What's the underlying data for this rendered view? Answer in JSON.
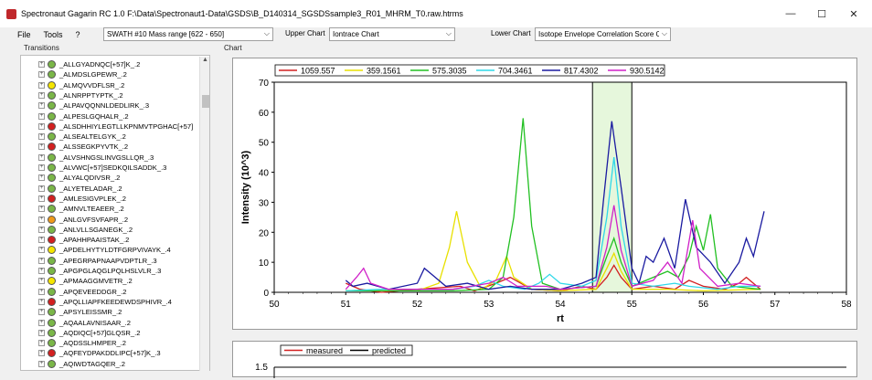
{
  "window": {
    "title": "Spectronaut Gagarin RC 1.0  F:\\Data\\Spectronaut1-Data\\GSDS\\B_D140314_SGSDSsample3_R01_MHRM_T0.raw.htrms",
    "minimize": "—",
    "maximize": "☐",
    "close": "✕"
  },
  "menu": {
    "file": "File",
    "tools": "Tools",
    "help": "?"
  },
  "toolbar": {
    "swath_select": "SWATH #10   Mass range [622 - 650]",
    "upper_chart_label": "Upper Chart",
    "upper_chart_select": "Iontrace Chart",
    "lower_chart_label": "Lower Chart",
    "lower_chart_select": "Isotope Envelope Correlation Score Ch"
  },
  "panels": {
    "transitions": "Transitions",
    "chart": "Chart"
  },
  "transitions": [
    {
      "label": "_ALLGYADNQC[+57]K_.2",
      "color": "#7ab648"
    },
    {
      "label": "_ALMDSLGPEWR_.2",
      "color": "#7ab648"
    },
    {
      "label": "_ALMQVVDFLSR_.2",
      "color": "#f4e500"
    },
    {
      "label": "_ALNRPPTYPTK_.2",
      "color": "#7ab648"
    },
    {
      "label": "_ALPAVQQNNLDEDLIRK_.3",
      "color": "#7ab648"
    },
    {
      "label": "_ALPESLGQHALR_.2",
      "color": "#7ab648"
    },
    {
      "label": "_ALSDHHIYLEGTLLKPNMVTPGHAC[+57]",
      "color": "#d22020"
    },
    {
      "label": "_ALSEALTELGYK_.2",
      "color": "#7ab648"
    },
    {
      "label": "_ALSSEGKPYVTK_.2",
      "color": "#d22020"
    },
    {
      "label": "_ALVSHNGSLINVGSLLQR_.3",
      "color": "#7ab648"
    },
    {
      "label": "_ALVWC[+57]SEDKQILSADDK_.3",
      "color": "#7ab648"
    },
    {
      "label": "_ALYALQDIVSR_.2",
      "color": "#7ab648"
    },
    {
      "label": "_ALYETELADAR_.2",
      "color": "#7ab648"
    },
    {
      "label": "_AMLESIGVPLEK_.2",
      "color": "#d22020"
    },
    {
      "label": "_AMNVLTEAEER_.2",
      "color": "#7ab648"
    },
    {
      "label": "_ANLGVFSVFAPR_.2",
      "color": "#f09a1a"
    },
    {
      "label": "_ANLVLLSGANEGK_.2",
      "color": "#7ab648"
    },
    {
      "label": "_APAHHPAAISTAK_.2",
      "color": "#d22020"
    },
    {
      "label": "_APDELHYTYLDTFGRPVIVAYK_.4",
      "color": "#f4e500"
    },
    {
      "label": "_APEGRPAPNAAPVDPTLR_.3",
      "color": "#7ab648"
    },
    {
      "label": "_APGPGLAQGLPQLHSLVLR_.3",
      "color": "#7ab648"
    },
    {
      "label": "_APMAAGGMVETR_.2",
      "color": "#f4e500"
    },
    {
      "label": "_APQEVEEDDGR_.2",
      "color": "#7ab648"
    },
    {
      "label": "_APQLLIAPFKEEDEWDSPHIVR_.4",
      "color": "#d22020"
    },
    {
      "label": "_APSYLEISSMR_.2",
      "color": "#7ab648"
    },
    {
      "label": "_AQAALAVNISAAR_.2",
      "color": "#7ab648"
    },
    {
      "label": "_AQDIQC[+57]GLQSR_.2",
      "color": "#7ab648"
    },
    {
      "label": "_AQDSSLHMPER_.2",
      "color": "#7ab648"
    },
    {
      "label": "_AQFEYDPAKDDLIPC[+57]K_.3",
      "color": "#d22020"
    },
    {
      "label": "_AQIWDTAGQER_.2",
      "color": "#7ab648"
    }
  ],
  "upper_chart": {
    "chart_data": {
      "type": "line",
      "xlabel": "rt",
      "ylabel": "Intensity (10^3)",
      "xlim": [
        50,
        58
      ],
      "ylim": [
        0,
        70
      ],
      "xticks": [
        "50",
        "51",
        "52",
        "53",
        "54",
        "55",
        "56",
        "57",
        "58"
      ],
      "yticks": [
        "0",
        "10",
        "20",
        "30",
        "40",
        "50",
        "60",
        "70"
      ],
      "highlight_range": [
        54.45,
        55.0
      ],
      "legend_position": "top-left",
      "series": [
        {
          "name": "1059.557",
          "color": "#d22020",
          "points": [
            [
              51.0,
              3
            ],
            [
              51.2,
              1
            ],
            [
              51.5,
              0
            ],
            [
              52.0,
              1
            ],
            [
              52.6,
              2
            ],
            [
              52.8,
              0.5
            ],
            [
              53.1,
              3
            ],
            [
              53.3,
              5
            ],
            [
              53.6,
              1
            ],
            [
              54.0,
              0.5
            ],
            [
              54.3,
              2
            ],
            [
              54.5,
              1
            ],
            [
              54.65,
              5
            ],
            [
              54.75,
              9
            ],
            [
              54.85,
              5
            ],
            [
              55.0,
              1
            ],
            [
              55.3,
              2
            ],
            [
              55.6,
              1
            ],
            [
              55.8,
              4
            ],
            [
              56.0,
              2
            ],
            [
              56.3,
              1
            ],
            [
              56.5,
              3
            ],
            [
              56.6,
              5
            ],
            [
              56.8,
              1
            ]
          ]
        },
        {
          "name": "359.1561",
          "color": "#e8e000",
          "points": [
            [
              51.0,
              0.5
            ],
            [
              51.5,
              0.5
            ],
            [
              52.0,
              0.5
            ],
            [
              52.3,
              3
            ],
            [
              52.45,
              15
            ],
            [
              52.55,
              27
            ],
            [
              52.7,
              10
            ],
            [
              52.9,
              1
            ],
            [
              53.1,
              4
            ],
            [
              53.25,
              12
            ],
            [
              53.35,
              5
            ],
            [
              53.6,
              1
            ],
            [
              54.0,
              0.5
            ],
            [
              54.5,
              1
            ],
            [
              54.65,
              8
            ],
            [
              54.75,
              13
            ],
            [
              54.85,
              7
            ],
            [
              55.0,
              1
            ],
            [
              55.5,
              1
            ],
            [
              56.0,
              0.5
            ],
            [
              56.8,
              1
            ]
          ]
        },
        {
          "name": "575.3035",
          "color": "#22c022",
          "points": [
            [
              51.0,
              0.5
            ],
            [
              51.5,
              0.5
            ],
            [
              52.0,
              0.5
            ],
            [
              52.5,
              0.5
            ],
            [
              53.0,
              1
            ],
            [
              53.2,
              5
            ],
            [
              53.35,
              25
            ],
            [
              53.48,
              58
            ],
            [
              53.6,
              22
            ],
            [
              53.75,
              3
            ],
            [
              54.0,
              1
            ],
            [
              54.5,
              2
            ],
            [
              54.65,
              12
            ],
            [
              54.75,
              18
            ],
            [
              54.85,
              10
            ],
            [
              55.0,
              2
            ],
            [
              55.2,
              4
            ],
            [
              55.5,
              7
            ],
            [
              55.65,
              5
            ],
            [
              55.8,
              12
            ],
            [
              55.9,
              22
            ],
            [
              56.0,
              14
            ],
            [
              56.1,
              26
            ],
            [
              56.2,
              8
            ],
            [
              56.4,
              2
            ],
            [
              56.8,
              1
            ]
          ]
        },
        {
          "name": "704.3461",
          "color": "#2fd8e8",
          "points": [
            [
              51.0,
              0.5
            ],
            [
              51.5,
              1
            ],
            [
              52.0,
              1
            ],
            [
              52.5,
              1
            ],
            [
              52.8,
              2
            ],
            [
              53.0,
              4
            ],
            [
              53.2,
              2
            ],
            [
              53.5,
              1
            ],
            [
              53.7,
              3
            ],
            [
              53.85,
              6
            ],
            [
              54.0,
              3
            ],
            [
              54.3,
              2
            ],
            [
              54.5,
              4
            ],
            [
              54.65,
              25
            ],
            [
              54.75,
              45
            ],
            [
              54.85,
              22
            ],
            [
              55.0,
              3
            ],
            [
              55.3,
              2
            ],
            [
              55.6,
              3
            ],
            [
              55.8,
              2
            ],
            [
              56.2,
              1
            ],
            [
              56.5,
              2
            ],
            [
              56.8,
              2
            ]
          ]
        },
        {
          "name": "817.4302",
          "color": "#1a1aa0",
          "points": [
            [
              51.0,
              4
            ],
            [
              51.1,
              2
            ],
            [
              51.3,
              3
            ],
            [
              51.6,
              1
            ],
            [
              52.0,
              3
            ],
            [
              52.1,
              8
            ],
            [
              52.2,
              6
            ],
            [
              52.4,
              2
            ],
            [
              52.7,
              3
            ],
            [
              53.0,
              1
            ],
            [
              53.3,
              2
            ],
            [
              53.6,
              1
            ],
            [
              54.0,
              1
            ],
            [
              54.3,
              3
            ],
            [
              54.5,
              5
            ],
            [
              54.6,
              30
            ],
            [
              54.72,
              57
            ],
            [
              54.85,
              35
            ],
            [
              55.0,
              8
            ],
            [
              55.1,
              3
            ],
            [
              55.2,
              12
            ],
            [
              55.3,
              10
            ],
            [
              55.45,
              18
            ],
            [
              55.6,
              8
            ],
            [
              55.75,
              31
            ],
            [
              55.9,
              15
            ],
            [
              56.1,
              10
            ],
            [
              56.3,
              3
            ],
            [
              56.5,
              10
            ],
            [
              56.6,
              18
            ],
            [
              56.7,
              12
            ],
            [
              56.85,
              27
            ]
          ]
        },
        {
          "name": "930.5142",
          "color": "#d020c8",
          "points": [
            [
              51.0,
              1
            ],
            [
              51.15,
              5
            ],
            [
              51.25,
              8
            ],
            [
              51.35,
              3
            ],
            [
              51.6,
              1
            ],
            [
              52.0,
              1
            ],
            [
              52.5,
              1
            ],
            [
              53.0,
              3
            ],
            [
              53.2,
              5
            ],
            [
              53.4,
              2
            ],
            [
              53.8,
              2
            ],
            [
              54.0,
              1
            ],
            [
              54.5,
              2
            ],
            [
              54.65,
              15
            ],
            [
              54.75,
              29
            ],
            [
              54.85,
              14
            ],
            [
              55.0,
              2
            ],
            [
              55.3,
              4
            ],
            [
              55.5,
              10
            ],
            [
              55.7,
              3
            ],
            [
              55.85,
              24
            ],
            [
              55.95,
              8
            ],
            [
              56.2,
              2
            ],
            [
              56.5,
              3
            ],
            [
              56.8,
              2
            ]
          ]
        }
      ]
    }
  },
  "lower_chart": {
    "chart_data": {
      "type": "line",
      "series": [
        {
          "name": "measured",
          "color": "#d22020"
        },
        {
          "name": "predicted",
          "color": "#000000"
        }
      ],
      "yticks": [
        "1.5"
      ],
      "legend_position": "top-left"
    }
  }
}
